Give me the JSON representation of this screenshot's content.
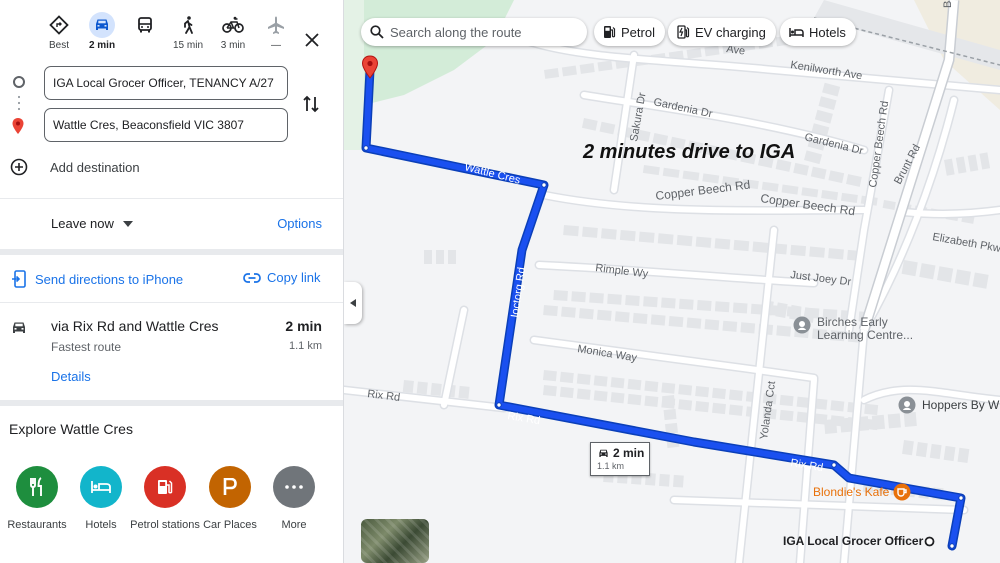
{
  "travel_modes": [
    {
      "id": "best",
      "label": "Best"
    },
    {
      "id": "drive",
      "label": "2 min"
    },
    {
      "id": "transit",
      "label": ""
    },
    {
      "id": "walk",
      "label": "15 min"
    },
    {
      "id": "cycle",
      "label": "3 min"
    },
    {
      "id": "flight",
      "label": "—"
    }
  ],
  "origin": "IGA Local Grocer Officer, TENANCY A/27",
  "destination": "Wattle Cres, Beaconsfield VIC 3807",
  "add_destination": "Add destination",
  "leave_now": "Leave now",
  "options": "Options",
  "send_to_phone": "Send directions to iPhone",
  "copy_link": "Copy link",
  "route": {
    "name": "via Rix Rd and Wattle Cres",
    "subtitle": "Fastest route",
    "time": "2 min",
    "distance": "1.1 km",
    "details": "Details"
  },
  "explore": {
    "title": "Explore Wattle Cres",
    "items": [
      {
        "label": "Restaurants",
        "color": "#1e8e3e"
      },
      {
        "label": "Hotels",
        "color": "#12b5cb"
      },
      {
        "label": "Petrol stations",
        "color": "#d93025"
      },
      {
        "label": "Car Places",
        "color": "#c26401"
      },
      {
        "label": "More",
        "color": "#70757a"
      }
    ]
  },
  "map": {
    "search_placeholder": "Search along the route",
    "chips": [
      "Petrol",
      "EV charging",
      "Hotels"
    ],
    "annotation": "2 minutes drive to IGA",
    "badge_time": "2 min",
    "badge_distance": "1.1 km",
    "route_color": "#1a50f0",
    "streets": {
      "kenilworth": "Kenilworth Ave",
      "ave": "Ave",
      "gardenia1": "Gardenia Dr",
      "gardenia2": "Gardenia Dr",
      "sakura": "Sakura Dr",
      "copper_beech1": "Copper Beech Rd",
      "copper_beech2": "Copper Beech Rd",
      "copper_beech_v": "Copper Beech Rd",
      "brunt": "Brunt Rd",
      "brunt_top": "Brunt",
      "elizabeth": "Elizabeth Pkwy",
      "wattle": "Wattle Cres",
      "ioctorg": "Ioctorg Rd",
      "rimple": "Rimple Wy",
      "just_joey": "Just Joey Dr",
      "monica": "Monica Way",
      "rix_left": "Rix Rd",
      "rix_route": "Rix Rd",
      "rix_route2": "Rix Rd",
      "yolanda": "Yolanda Cct"
    },
    "pois": {
      "birches": "Birches Early Learning Centre...",
      "hoppers": "Hoppers By W",
      "blondies": "Blondie's Kafe",
      "iga": "IGA Local Grocer Officer"
    }
  }
}
